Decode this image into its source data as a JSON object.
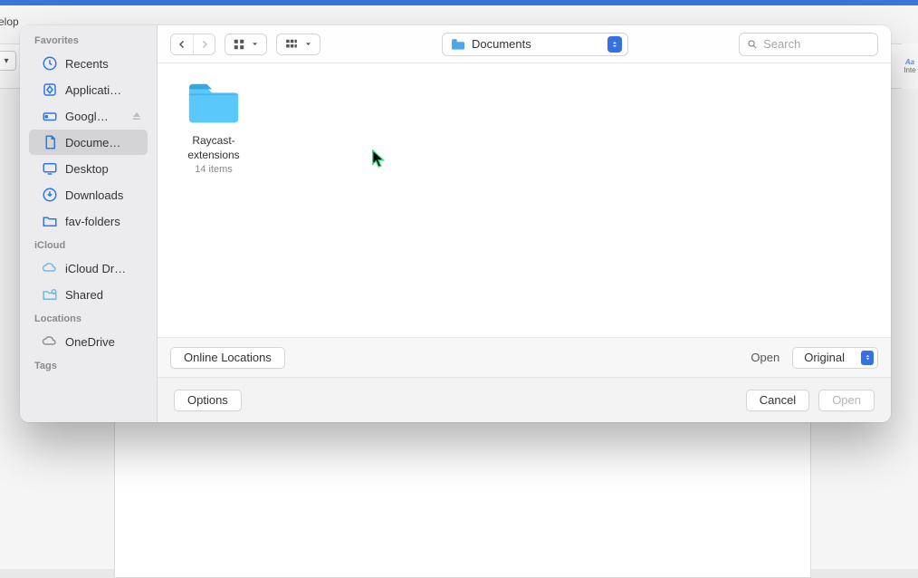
{
  "background": {
    "tab_text": "elop",
    "right_label_a": "Aa",
    "right_label_b": "Inte"
  },
  "dialog": {
    "sidebar": {
      "sections": [
        {
          "header": "Favorites",
          "items": [
            {
              "icon": "recents",
              "label": "Recents",
              "selected": false,
              "eject": false
            },
            {
              "icon": "applications",
              "label": "Applicati…",
              "selected": false,
              "eject": false
            },
            {
              "icon": "google",
              "label": "Googl…",
              "selected": false,
              "eject": true
            },
            {
              "icon": "documents",
              "label": "Docume…",
              "selected": true,
              "eject": false
            },
            {
              "icon": "desktop",
              "label": "Desktop",
              "selected": false,
              "eject": false
            },
            {
              "icon": "downloads",
              "label": "Downloads",
              "selected": false,
              "eject": false
            },
            {
              "icon": "folder",
              "label": "fav-folders",
              "selected": false,
              "eject": false
            }
          ]
        },
        {
          "header": "iCloud",
          "items": [
            {
              "icon": "icloud",
              "label": "iCloud Dr…",
              "selected": false,
              "eject": false
            },
            {
              "icon": "shared",
              "label": "Shared",
              "selected": false,
              "eject": false
            }
          ]
        },
        {
          "header": "Locations",
          "items": [
            {
              "icon": "onedrive",
              "label": "OneDrive",
              "selected": false,
              "eject": false
            }
          ]
        },
        {
          "header": "Tags",
          "items": []
        }
      ]
    },
    "toolbar": {
      "location_label": "Documents",
      "search_placeholder": "Search"
    },
    "content": {
      "items": [
        {
          "name": "Raycast-extensions",
          "meta": "14 items",
          "type": "folder"
        }
      ]
    },
    "options_bar": {
      "online_locations_label": "Online Locations",
      "open_label": "Open",
      "open_mode": "Original"
    },
    "buttons_bar": {
      "options_label": "Options",
      "cancel_label": "Cancel",
      "open_label": "Open"
    }
  }
}
